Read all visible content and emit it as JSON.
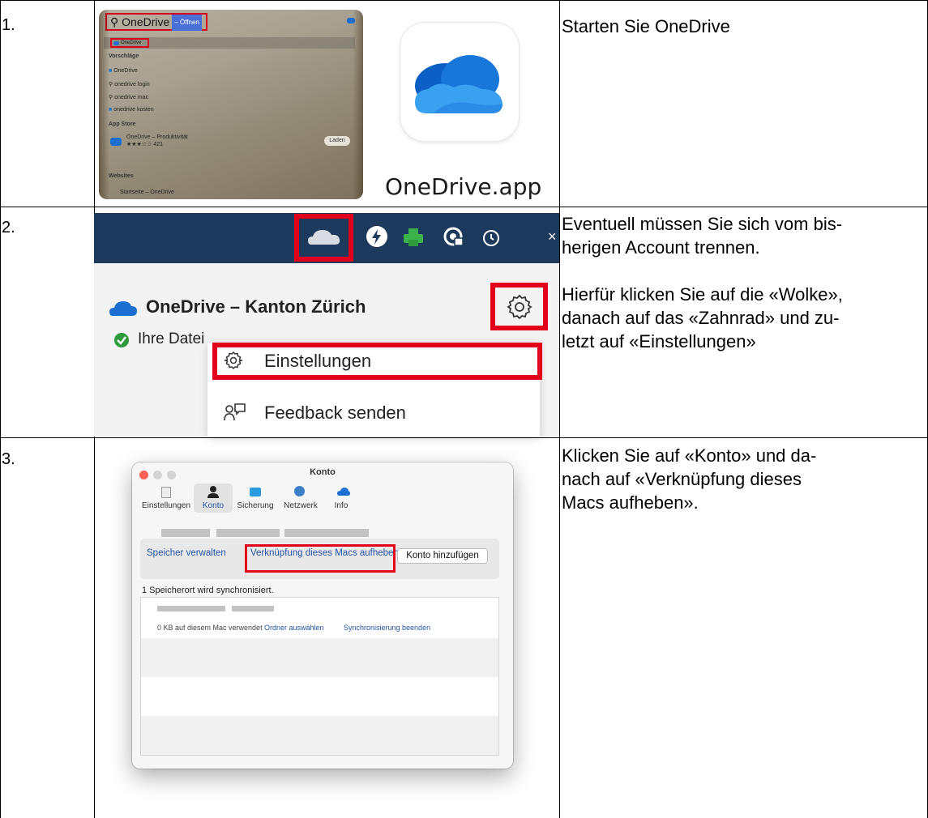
{
  "rows": [
    {
      "num": "1.",
      "text": [
        "Starten Sie OneDrive"
      ]
    },
    {
      "num": "2.",
      "text": [
        "Eventuell müssen Sie sich vom bis-",
        "herigen Account trennen.",
        "",
        "Hierfür klicken Sie auf die «Wolke»,",
        "danach auf das «Zahnrad» und zu-",
        "letzt auf «Einstellungen»"
      ]
    },
    {
      "num": "3.",
      "text": [
        "Klicken Sie auf «Konto» und da-",
        "nach auf «Verknüpfung dieses",
        "Macs aufheben»."
      ]
    }
  ],
  "spotlight": {
    "query": "OneDrive",
    "open_badge": "– Öffnen",
    "top_hit": "OneDrive",
    "section_suggestions": "Vorschläge",
    "suggestions": [
      "OneDrive",
      "onedrive login",
      "onedrive mac",
      "onedrive kosten"
    ],
    "section_appstore": "App Store",
    "appstore_item": "OneDrive – Produktivität",
    "appstore_rating": "★★★☆☆ 421",
    "appstore_button": "Laden",
    "section_websites": "Websites",
    "website_item": "Startseite – OneDrive"
  },
  "app_label": "OneDrive.app",
  "onedrive_menu": {
    "title": "OneDrive – Kanton Zürich",
    "status": "Ihre Datei",
    "items": [
      "Einstellungen",
      "Feedback senden"
    ]
  },
  "prefs": {
    "window_title": "Konto",
    "tabs": [
      "Einstellungen",
      "Konto",
      "Sicherung",
      "Netzwerk",
      "Info"
    ],
    "links": [
      "Speicher verwalten",
      "Verknüpfung dieses Macs aufheben"
    ],
    "add_account_button": "Konto hinzufügen",
    "sync_label": "1 Speicherort wird synchronisiert.",
    "usage_text": "0 KB auf diesem Mac verwendet",
    "choose_folders": "Ordner auswählen",
    "stop_sync": "Synchronisierung beenden"
  },
  "colors": {
    "highlight_red": "#e2001a",
    "onedrive_blue": "#1c6fd0",
    "menubar": "#1d3a5c"
  }
}
